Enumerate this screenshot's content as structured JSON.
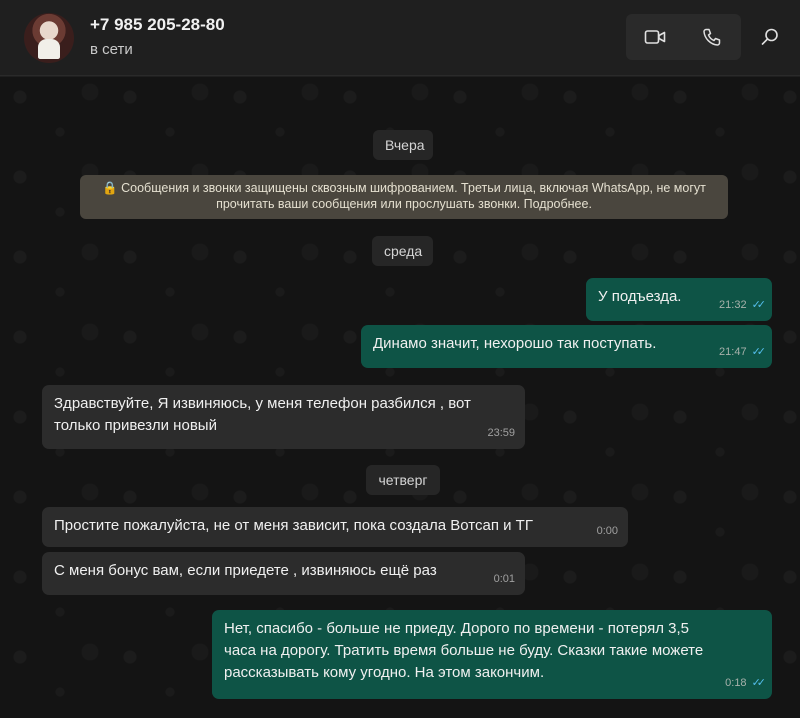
{
  "header": {
    "contact_name": "+7 985 205-28-80",
    "status": "в сети",
    "icons": [
      "video-call-icon",
      "voice-call-icon",
      "search-icon"
    ]
  },
  "chat": {
    "date_yesterday": "Вчера",
    "encryption_notice_line1": "🔒 Сообщения и звонки защищены сквозным шифрованием. Третьи лица, включая WhatsApp, не могут",
    "encryption_notice_line2": "прочитать ваши сообщения или прослушать звонки. Подробнее.",
    "date_wednesday": "среда",
    "date_thursday": "четверг",
    "messages": [
      {
        "dir": "out",
        "text": "У подъезда.",
        "time": "21:32",
        "read": true
      },
      {
        "dir": "out",
        "text": "Динамо значит, нехорошо так поступать.",
        "time": "21:47",
        "read": true
      },
      {
        "dir": "in",
        "text_line1": "Здравствуйте, Я извиняюсь, у меня телефон разбился , вот",
        "text_line2": "только привезли новый",
        "time": "23:59"
      },
      {
        "dir": "in",
        "text": "Простите пожалуйста, не от меня зависит, пока создала Вотсап и ТГ",
        "time": "0:00"
      },
      {
        "dir": "in",
        "text": "С меня бонус вам, если приедете , извиняюсь ещё раз",
        "time": "0:01"
      },
      {
        "dir": "out",
        "text_line1": "Нет, спасибо - больше не приеду. Дорого по времени - потерял 3,5",
        "text_line2": "часа на дорогу. Тратить время больше не буду. Сказки такие можете",
        "text_line3": "рассказывать кому угодно. На этом закончим.",
        "time": "0:18",
        "read": true
      }
    ]
  },
  "colors": {
    "background": "#141414",
    "header": "#1f1f1f",
    "incoming_bubble": "#2c2c2c",
    "outgoing_bubble": "#0e5446",
    "read_ticks": "#53bdeb",
    "encryption_notice": "#4a463e"
  }
}
